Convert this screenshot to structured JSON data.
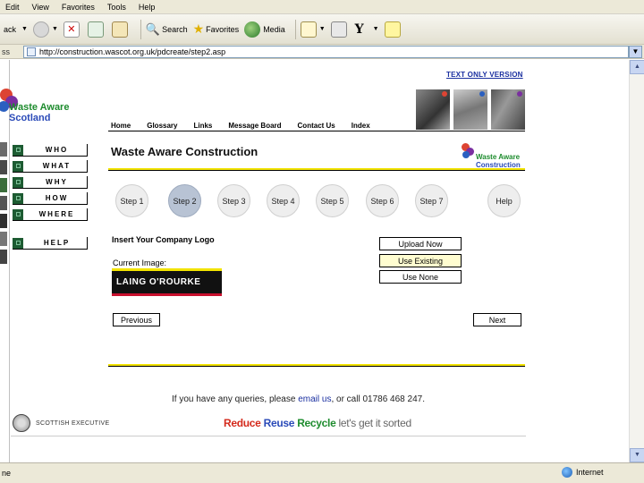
{
  "browser": {
    "menus": [
      "Edit",
      "View",
      "Favorites",
      "Tools",
      "Help"
    ],
    "toolbar": {
      "back_label": "ack",
      "search_label": "Search",
      "favorites_label": "Favorites",
      "media_label": "Media"
    },
    "address": {
      "label": "ss",
      "url": "http://construction.wascot.org.uk/pdcreate/step2.asp"
    },
    "status": {
      "left": "ne",
      "zone": "Internet"
    }
  },
  "page": {
    "text_only": "TEXT ONLY VERSION",
    "logo": {
      "line1": "Waste Aware",
      "line2": "Scotland"
    },
    "topnav": [
      "Home",
      "Glossary",
      "Links",
      "Message Board",
      "Contact Us",
      "Index"
    ],
    "sidenav": [
      "WHO",
      "WHAT",
      "WHY",
      "HOW",
      "WHERE"
    ],
    "side_help": "HELP",
    "title": "Waste Aware Construction",
    "small_logo": {
      "line1": "Waste Aware",
      "line2": "Construction"
    },
    "steps": [
      "Step 1",
      "Step 2",
      "Step 3",
      "Step 4",
      "Step 5",
      "Step 6",
      "Step 7",
      "Help"
    ],
    "active_step": "Step 2",
    "logo_heading": "Insert Your Company Logo",
    "current_image_label": "Current Image:",
    "company_logo_text": "LAING O'ROURKE",
    "actions": {
      "upload": "Upload Now",
      "existing": "Use Existing",
      "none": "Use None"
    },
    "previous": "Previous",
    "next": "Next",
    "queries": {
      "pre": "If you have any queries, please ",
      "link": "email us",
      "post": ", or call 01786 468 247."
    },
    "footer": {
      "exec": "SCOTTISH EXECUTIVE",
      "reduce": "Reduce",
      "reuse": "Reuse",
      "recycle": "Recycle",
      "sorted": "let's get it sorted"
    }
  },
  "colors": {
    "rule_yellow": "#f2e300",
    "link_blue": "#1a2fa0",
    "side_green": "#1d5b32",
    "active_step": "#b8c3d4"
  }
}
